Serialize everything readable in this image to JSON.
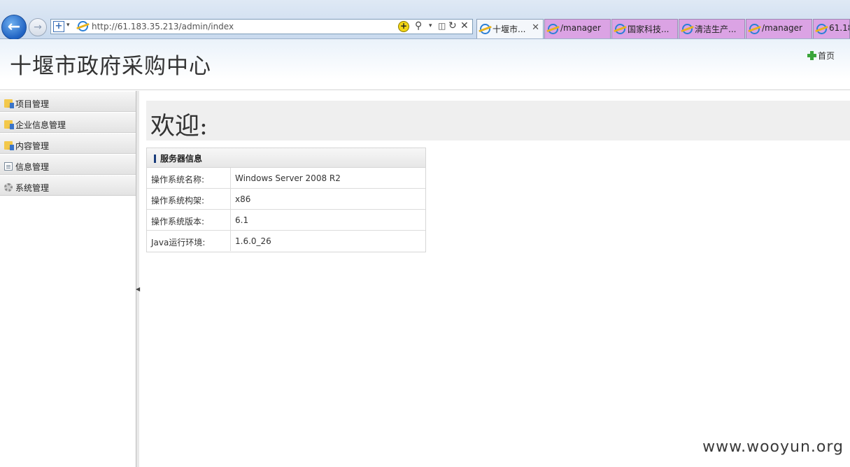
{
  "browser": {
    "url": "http://61.183.35.213/admin/index",
    "tabs": [
      {
        "label": "十堰市...",
        "active": true
      },
      {
        "label": "/manager",
        "active": false
      },
      {
        "label": "国家科技...",
        "active": false
      },
      {
        "label": "清洁生产...",
        "active": false
      },
      {
        "label": "/manager",
        "active": false
      },
      {
        "label": "61.18",
        "active": false
      }
    ],
    "tab_close": "✕"
  },
  "header": {
    "title": "十堰市政府采购中心",
    "home_link": "首页"
  },
  "sidebar": {
    "items": [
      {
        "label": "项目管理",
        "icon": "folder-icon"
      },
      {
        "label": "企业信息管理",
        "icon": "folder-icon"
      },
      {
        "label": "内容管理",
        "icon": "folder-icon"
      },
      {
        "label": "信息管理",
        "icon": "document-icon"
      },
      {
        "label": "系统管理",
        "icon": "gear-icon"
      }
    ]
  },
  "main": {
    "welcome": "欢迎:",
    "server_info": {
      "title": "服务器信息",
      "rows": [
        {
          "key": "操作系统名称:",
          "value": "Windows Server 2008 R2"
        },
        {
          "key": "操作系统构架:",
          "value": "x86"
        },
        {
          "key": "操作系统版本:",
          "value": "6.1"
        },
        {
          "key": "Java运行环境:",
          "value": "1.6.0_26"
        }
      ]
    }
  },
  "watermark": "www.wooyun.org",
  "colors": {
    "tab_inactive": "#dba3e4",
    "header_gradient_top": "#eaf2fa",
    "plus_icon": "#3aa53a",
    "back_button": "#1f62c2"
  }
}
